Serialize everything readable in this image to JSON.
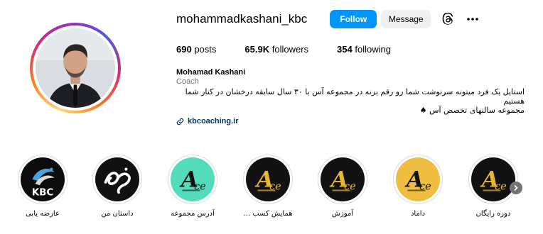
{
  "profile": {
    "username": "mohammadkashani_kbc",
    "follow_label": "Follow",
    "message_label": "Message",
    "threads_icon": "threads-icon",
    "more_icon": "more-icon"
  },
  "stats": {
    "posts_count": "690",
    "posts_label": "posts",
    "followers_count": "65.9K",
    "followers_label": "followers",
    "following_count": "354",
    "following_label": "following"
  },
  "bio": {
    "name": "Mohamad Kashani",
    "category": "Coach",
    "line1": "استایل یک فرد میتونه سرنوشت شما رو رقم بزنه در مجموعه آس با ۳۰ سال سابقه درخشان در کنار شما هستیم",
    "line2": "مجموعه سالنهای تخصص آس ♠",
    "link": "kbcoaching.ir",
    "link_icon": "link-icon"
  },
  "highlights": [
    {
      "label": "دوره رایگان",
      "style": "ace-dark"
    },
    {
      "label": "داماد",
      "style": "ace-gold"
    },
    {
      "label": "آموزش",
      "style": "ace-dark"
    },
    {
      "label": "همایش کسب ...",
      "style": "ace-dark"
    },
    {
      "label": "آدرس مجموعه",
      "style": "ace-mint"
    },
    {
      "label": "داستان من",
      "style": "calligraphy"
    },
    {
      "label": "عارضه یابی",
      "style": "kbc"
    }
  ],
  "colors": {
    "follow_button": "#0095f6",
    "message_button": "#efefef",
    "link": "#00376b",
    "ace_gold": "#e8b634",
    "ace_mint": "#4dd9b8"
  }
}
